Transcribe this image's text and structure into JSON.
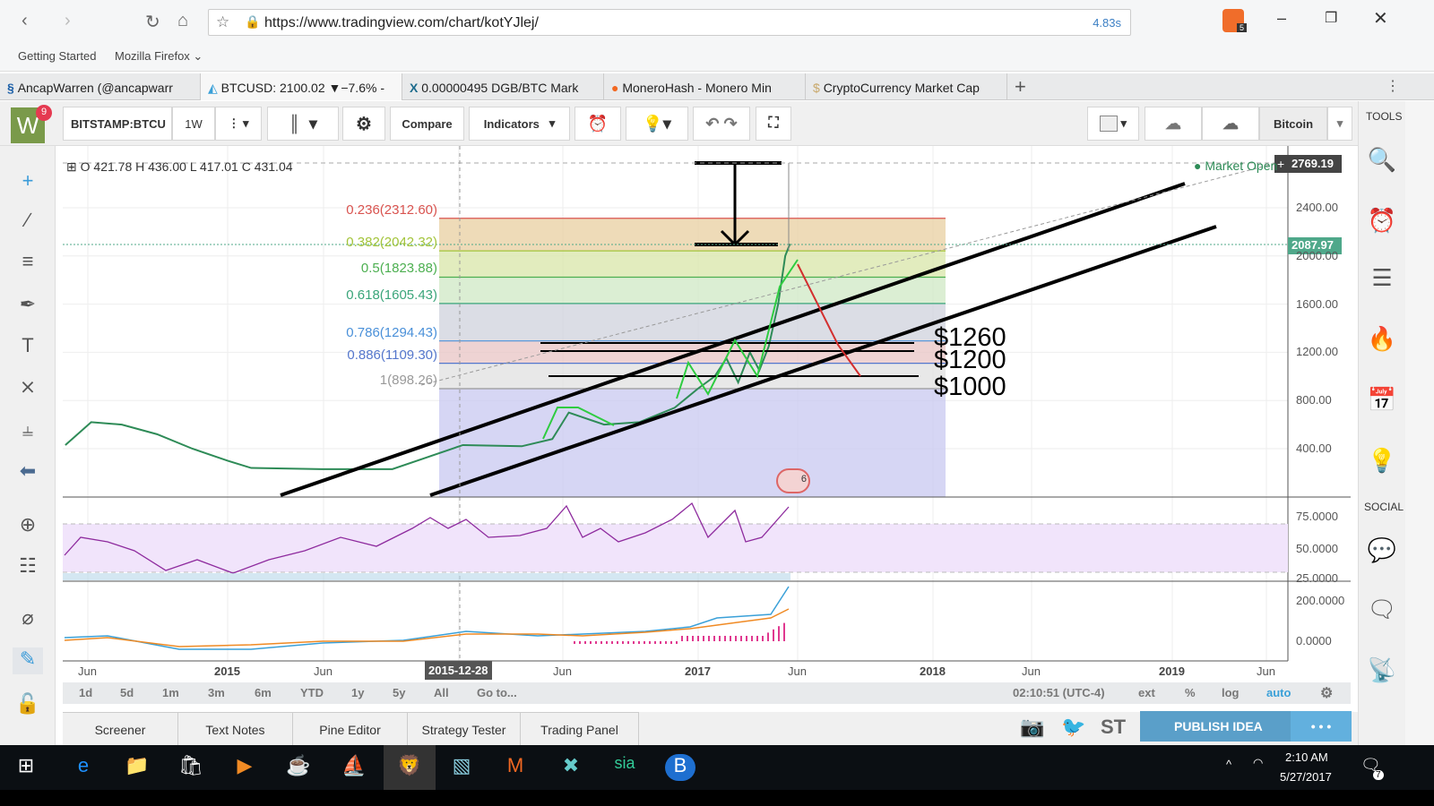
{
  "browser": {
    "url": "https://www.tradingview.com/chart/kotYJlej/",
    "load_time": "4.83s",
    "brave_badge": "5",
    "bookmarks": [
      "Getting Started",
      "Mozilla Firefox"
    ],
    "tabs": [
      "AncapWarren (@ancapwarr",
      "BTCUSD: 2100.02 ▼−7.6% -",
      "0.00000495 DGB/BTC Mark",
      "MoneroHash - Monero Min",
      "CryptoCurrency Market Cap"
    ]
  },
  "toolbar": {
    "avatar": "W",
    "notifications": "9",
    "symbol": "BITSTAMP:BTCU",
    "interval": "1W",
    "compare": "Compare",
    "indicators": "Indicators",
    "layout": "Bitcoin"
  },
  "right_panel": {
    "tools": "TOOLS",
    "social": "SOCIAL"
  },
  "chart": {
    "ohlc": "O 421.78 H 436.00 L 417.01 C 431.04",
    "market_status": "Market Open",
    "high_label": "2769.19",
    "last_price": "2087.97",
    "price_ticks": [
      "2400.00",
      "2000.00",
      "1600.00",
      "1200.00",
      "800.00",
      "400.00"
    ],
    "rsi_ticks": [
      "75.0000",
      "50.0000",
      "25.0000"
    ],
    "macd_ticks": [
      "200.0000",
      "0.0000"
    ],
    "time_ticks": [
      "Jun",
      "2015",
      "Jun",
      "2015-12-28",
      "Jun",
      "2017",
      "Jun",
      "2018",
      "Jun",
      "2019",
      "Jun"
    ],
    "fib_levels": [
      {
        "label": "0.236(2312.60)",
        "price": 2312.6,
        "color": "#d9534f",
        "fill": "#e8cfa0"
      },
      {
        "label": "0.382(2042.32)",
        "price": 2042.32,
        "color": "#a3c43a",
        "fill": "#d8e6a8"
      },
      {
        "label": "0.5(1823.88)",
        "price": 1823.88,
        "color": "#4caf50",
        "fill": "#cfe8c4"
      },
      {
        "label": "0.618(1605.43)",
        "price": 1605.43,
        "color": "#3aa57a",
        "fill": "#cfd2dc"
      },
      {
        "label": "0.786(1294.43)",
        "price": 1294.43,
        "color": "#4a90d9",
        "fill": "#e8c4c4"
      },
      {
        "label": "0.886(1109.30)",
        "price": 1109.3,
        "color": "#5577cc",
        "fill": "#e0e0e0"
      },
      {
        "label": "1(898.26)",
        "price": 898.26,
        "color": "#999999",
        "fill": "#c8c8f0"
      }
    ],
    "annotations": [
      "$1260",
      "$1200",
      "$1000"
    ],
    "events_badge": "6",
    "price_series": [
      [
        2014.31,
        430
      ],
      [
        2014.42,
        620
      ],
      [
        2014.55,
        600
      ],
      [
        2014.7,
        520
      ],
      [
        2014.85,
        400
      ],
      [
        2015.0,
        300
      ],
      [
        2015.1,
        240
      ],
      [
        2015.4,
        230
      ],
      [
        2015.7,
        230
      ],
      [
        2015.85,
        330
      ],
      [
        2016.0,
        430
      ],
      [
        2016.25,
        420
      ],
      [
        2016.38,
        480
      ],
      [
        2016.45,
        700
      ],
      [
        2016.6,
        600
      ],
      [
        2016.75,
        620
      ],
      [
        2016.9,
        740
      ],
      [
        2017.0,
        900
      ],
      [
        2017.07,
        1000
      ],
      [
        2017.12,
        1150
      ],
      [
        2017.17,
        950
      ],
      [
        2017.22,
        1200
      ],
      [
        2017.26,
        1050
      ],
      [
        2017.3,
        1250
      ],
      [
        2017.34,
        1600
      ],
      [
        2017.37,
        2000
      ],
      [
        2017.39,
        2100
      ]
    ]
  },
  "range_bar": {
    "ranges": [
      "1d",
      "5d",
      "1m",
      "3m",
      "6m",
      "YTD",
      "1y",
      "5y",
      "All",
      "Go to..."
    ],
    "clock": "02:10:51 (UTC-4)",
    "options": [
      "ext",
      "%",
      "log",
      "auto"
    ]
  },
  "bottom_tabs": [
    "Screener",
    "Text Notes",
    "Pine Editor",
    "Strategy Tester",
    "Trading Panel"
  ],
  "share": {
    "st": "ST",
    "publish": "PUBLISH IDEA",
    "more": "• • •"
  },
  "taskbar": {
    "time": "2:10 AM",
    "date": "5/27/2017",
    "notif": "7"
  }
}
